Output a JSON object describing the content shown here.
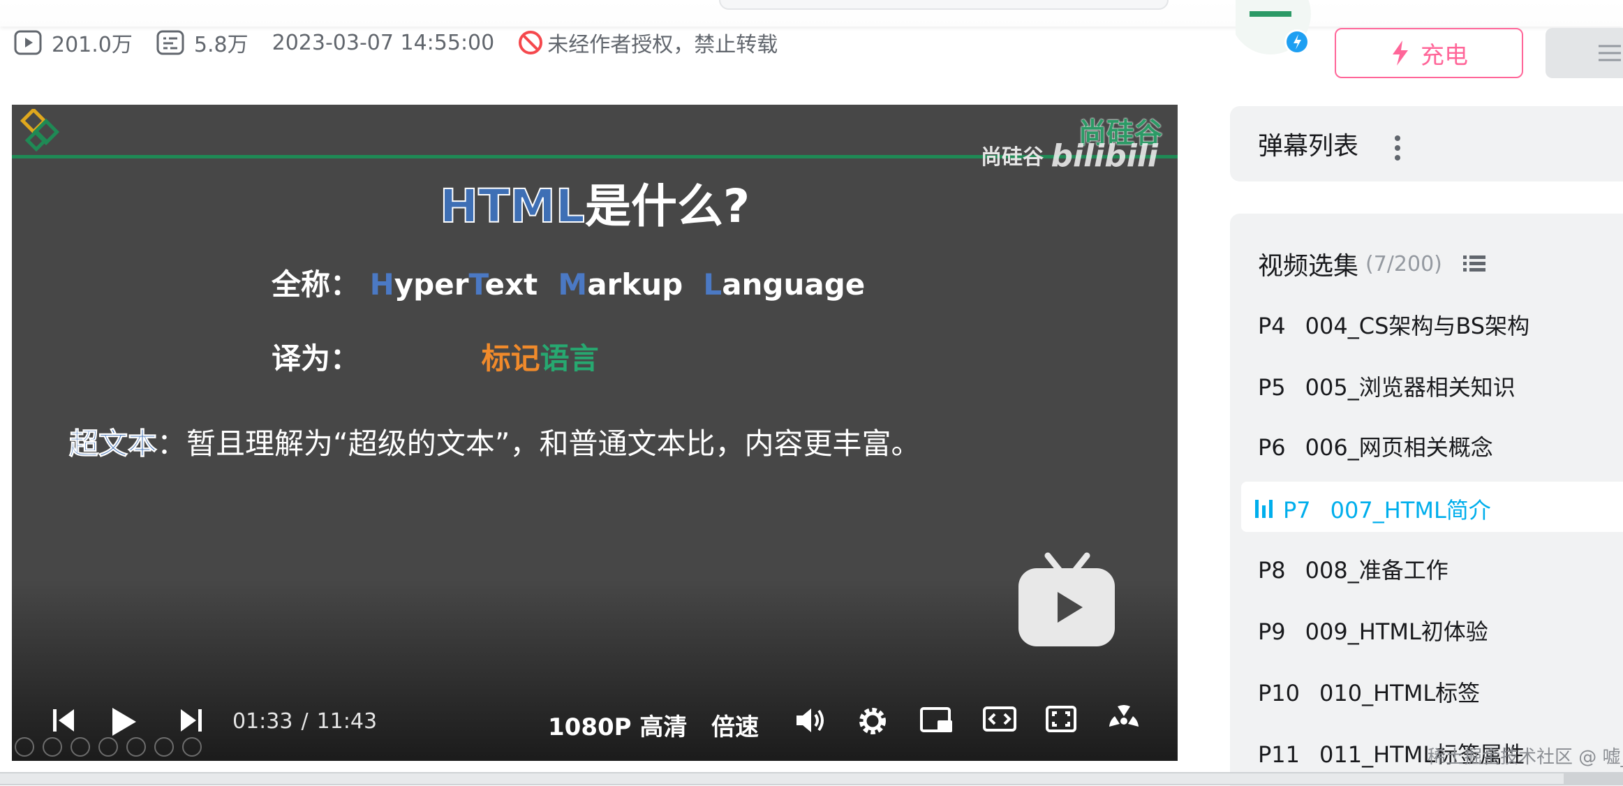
{
  "meta": {
    "views": "201.0万",
    "danmaku_count": "5.8万",
    "date": "2023-03-07 14:55:00",
    "copyright": "未经作者授权，禁止转载"
  },
  "slide": {
    "title_hl": "HTML",
    "title_rest": "是什么?",
    "fullname_label": "全称：",
    "fullname_parts": [
      "H",
      "yper",
      "T",
      "ext  ",
      "M",
      "arkup  ",
      "L",
      "anguage"
    ],
    "translate_label": "译为：",
    "translate_a": "标记",
    "translate_b": "语言",
    "hyper_term": "超文本",
    "hyper_desc": "：暂且理解为“超级的文本”，和普通文本比，内容更丰富。",
    "brand_left": "尚硅谷",
    "brand_right": "尚硅谷",
    "brand_bili": "bilibili"
  },
  "player": {
    "time_current": "01:33",
    "time_sep": "/",
    "time_total": "11:43",
    "quality": "1080P 高清",
    "speed": "倍速"
  },
  "side": {
    "charge_label": "充电",
    "danmaku_list": "弹幕列表",
    "episodes_title": "视频选集",
    "episodes_count": "(7/200)",
    "episodes": [
      {
        "p": "P4",
        "title": "004_CS架构与BS架构"
      },
      {
        "p": "P5",
        "title": "005_浏览器相关知识"
      },
      {
        "p": "P6",
        "title": "006_网页相关概念"
      },
      {
        "p": "P7",
        "title": "007_HTML简介"
      },
      {
        "p": "P8",
        "title": "008_准备工作"
      },
      {
        "p": "P9",
        "title": "009_HTML初体验"
      },
      {
        "p": "P10",
        "title": "010_HTML标签"
      },
      {
        "p": "P11",
        "title": "011_HTML标签属性"
      }
    ]
  },
  "watermark": "稀土掘金技术社区 @ 嘘_嘘",
  "colors": {
    "accent_pink": "#ff6699",
    "accent_blue": "#00aeec",
    "panel_bg": "#f1f2f3"
  }
}
